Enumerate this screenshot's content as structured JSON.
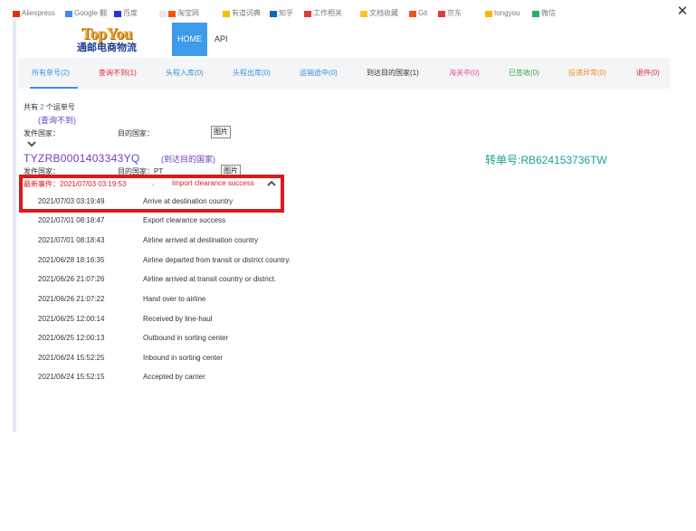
{
  "bookmarks": [
    {
      "label": "Aliexpress",
      "color": "#e62e04"
    },
    {
      "label": "Google 翻",
      "color": "#4285f4"
    },
    {
      "label": "百度",
      "color": "#2932e1"
    },
    {
      "label": "",
      "color": "#e8e8e8"
    },
    {
      "label": "淘宝网",
      "color": "#ff5000"
    },
    {
      "label": "有道词典",
      "color": "#f3c300"
    },
    {
      "label": "知乎",
      "color": "#0a66c2"
    },
    {
      "label": "工作相关",
      "color": "#e53935"
    },
    {
      "label": "文档收藏",
      "color": "#fbc02d"
    },
    {
      "label": "Git",
      "color": "#f4511e"
    },
    {
      "label": "京东",
      "color": "#e53935"
    },
    {
      "label": "tongyou",
      "color": "#ffb300"
    },
    {
      "label": "微信",
      "color": "#2aae67"
    }
  ],
  "close_label": "✕",
  "logo": {
    "en": "TopYou",
    "cn": "通邮电商物流"
  },
  "nav": {
    "home": "HOME",
    "api": "API"
  },
  "tabs": [
    {
      "label": "所有单号(2)",
      "color": "#3b92e1"
    },
    {
      "label": "查询不到(1)",
      "color": "#e02b2b"
    },
    {
      "label": "头程入库(0)",
      "color": "#3b92e1"
    },
    {
      "label": "头程出库(0)",
      "color": "#3b92e1"
    },
    {
      "label": "运输途中(0)",
      "color": "#3b92e1"
    },
    {
      "label": "到达目的国家(1)",
      "color": "#333333"
    },
    {
      "label": "海关中(0)",
      "color": "#e84e9a"
    },
    {
      "label": "已签收(0)",
      "color": "#3aa543"
    },
    {
      "label": "投递异常(0)",
      "color": "#f08c1e"
    },
    {
      "label": "退件(0)",
      "color": "#e02b2b"
    }
  ],
  "summary": {
    "prefix": "共有",
    "count": "2",
    "suffix": "个运单号"
  },
  "order1": {
    "status": "(查询不到)",
    "origin_label": "发件国家：",
    "dest_label": "目的国家：",
    "photo": "图片",
    "expand_icon": "chevron-down-icon"
  },
  "order2": {
    "tracking": "TYZRB0001403343YQ",
    "status": "(到达目的国家)",
    "transfer": "转单号:RB624153736TW",
    "origin_label": "发件国家：",
    "dest_label": "目的国家：PT",
    "photo": "图片",
    "latest_prefix": "最新事件：2021/07/03 03:19:53",
    "latest_sep": ",",
    "latest_event": "Import clearance success",
    "collapse_icon": "chevron-up-icon"
  },
  "events": [
    {
      "time": "2021/07/03 03:19:49",
      "desc": "Arrive at destination country"
    },
    {
      "time": "2021/07/01 08:18:47",
      "desc": "Export clearance success"
    },
    {
      "time": "2021/07/01 08:18:43",
      "desc": "Airline arrived at destination country"
    },
    {
      "time": "2021/06/28 18:16:35",
      "desc": "Airline departed from transit or district country."
    },
    {
      "time": "2021/06/26 21:07:26",
      "desc": "Airline arrived at transit country or district."
    },
    {
      "time": "2021/06/26 21:07:22",
      "desc": "Hand over to airline"
    },
    {
      "time": "2021/06/25 12:00:14",
      "desc": "Received by line-haul"
    },
    {
      "time": "2021/06/25 12:00:13",
      "desc": "Outbound in sorting center"
    },
    {
      "time": "2021/06/24 15:52:25",
      "desc": "Inbound in sorting center"
    },
    {
      "time": "2021/06/24 15:52:15",
      "desc": "Accepted by carrier"
    }
  ],
  "colors": {
    "accent_blue": "#3d9be9",
    "tracking_purple": "#6a3fbf",
    "transfer_teal": "#17a397",
    "alert_red": "#dd1a1a"
  }
}
